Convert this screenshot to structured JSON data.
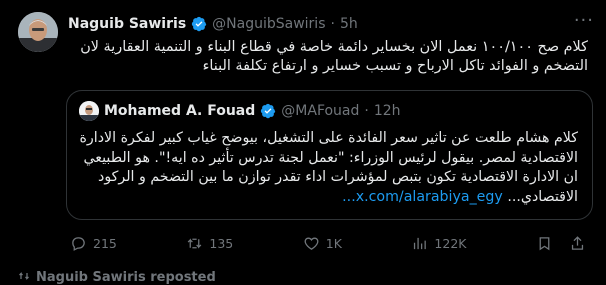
{
  "tweet": {
    "author_name": "Naguib Sawiris",
    "handle": "@NaguibSawiris",
    "separator": "·",
    "time": "5h",
    "text": "كلام صح ١٠٠/١٠٠ نعمل الان بخساير دائمة خاصة في قطاع البناء و التنمية العقارية لان التضخم و الفوائد تاكل الارباح و تسبب خساير و ارتفاع تكلفة البناء"
  },
  "quote": {
    "author_name": "Mohamed A. Fouad",
    "handle": "@MAFouad",
    "separator": "·",
    "time": "12h",
    "text": "كلام هشام طلعت عن تاثير سعر الفائدة على التشغيل، بيوضح غياب كبير لفكرة الادارة الاقتصادية لمصر. بيقول لرئيس الوزراء: \"نعمل لجنة تدرس تأثير ده ايه!\". هو الطبيعي ان الادارة الاقتصادية تكون بتبص لمؤشرات اداء تقدر توازن ما بين التضخم و الركود الاقتصادي... ",
    "link": "x.com/alarabiya_egy..."
  },
  "actions": {
    "replies": "215",
    "retweets": "135",
    "likes": "1K",
    "views": "122K"
  },
  "footer": {
    "text": "Naguib Sawiris reposted"
  },
  "colors": {
    "background": "#000000",
    "text": "#e7e9ea",
    "muted": "#71767b",
    "accent": "#1d9bf0"
  }
}
